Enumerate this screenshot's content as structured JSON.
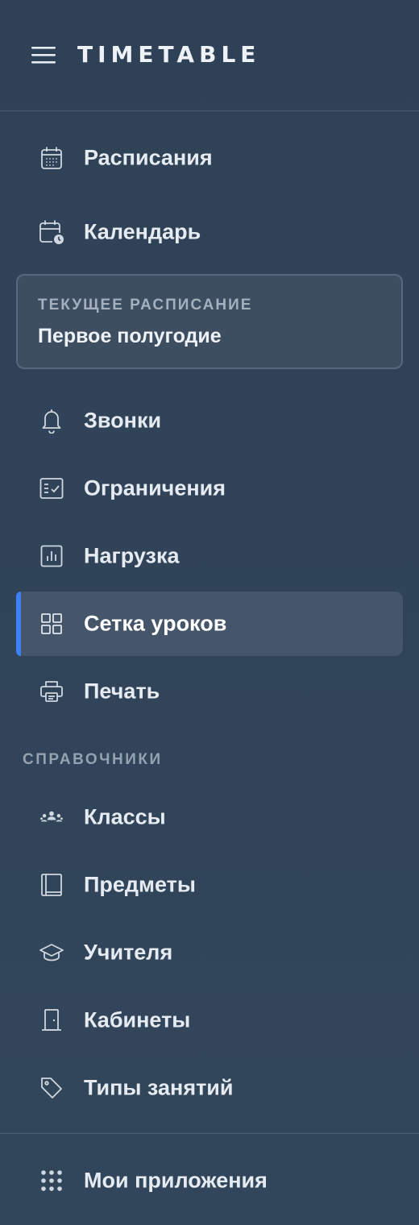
{
  "header": {
    "brand": "TIMETABLE"
  },
  "nav_primary": [
    {
      "label": "Расписания",
      "icon": "calendar-grid-icon"
    },
    {
      "label": "Календарь",
      "icon": "calendar-clock-icon"
    }
  ],
  "current_schedule": {
    "title": "ТЕКУЩЕЕ РАСПИСАНИЕ",
    "value": "Первое полугодие"
  },
  "nav_schedule": [
    {
      "label": "Звонки",
      "icon": "bell-icon"
    },
    {
      "label": "Ограничения",
      "icon": "checklist-icon"
    },
    {
      "label": "Нагрузка",
      "icon": "bar-chart-icon"
    },
    {
      "label": "Сетка уроков",
      "icon": "grid-icon",
      "active": true
    },
    {
      "label": "Печать",
      "icon": "printer-icon"
    }
  ],
  "references": {
    "title": "СПРАВОЧНИКИ",
    "items": [
      {
        "label": "Классы",
        "icon": "people-group-icon"
      },
      {
        "label": "Предметы",
        "icon": "book-icon"
      },
      {
        "label": "Учителя",
        "icon": "graduation-cap-icon"
      },
      {
        "label": "Кабинеты",
        "icon": "door-icon"
      },
      {
        "label": "Типы занятий",
        "icon": "tag-icon"
      }
    ]
  },
  "footer": {
    "apps_label": "Мои приложения",
    "apps_icon": "apps-grid-icon"
  },
  "colors": {
    "background": "#2f4156",
    "active_background": "#45566a",
    "active_accent": "#3b82f6",
    "text": "#e6ebf1",
    "muted_text": "#95a2b1"
  }
}
